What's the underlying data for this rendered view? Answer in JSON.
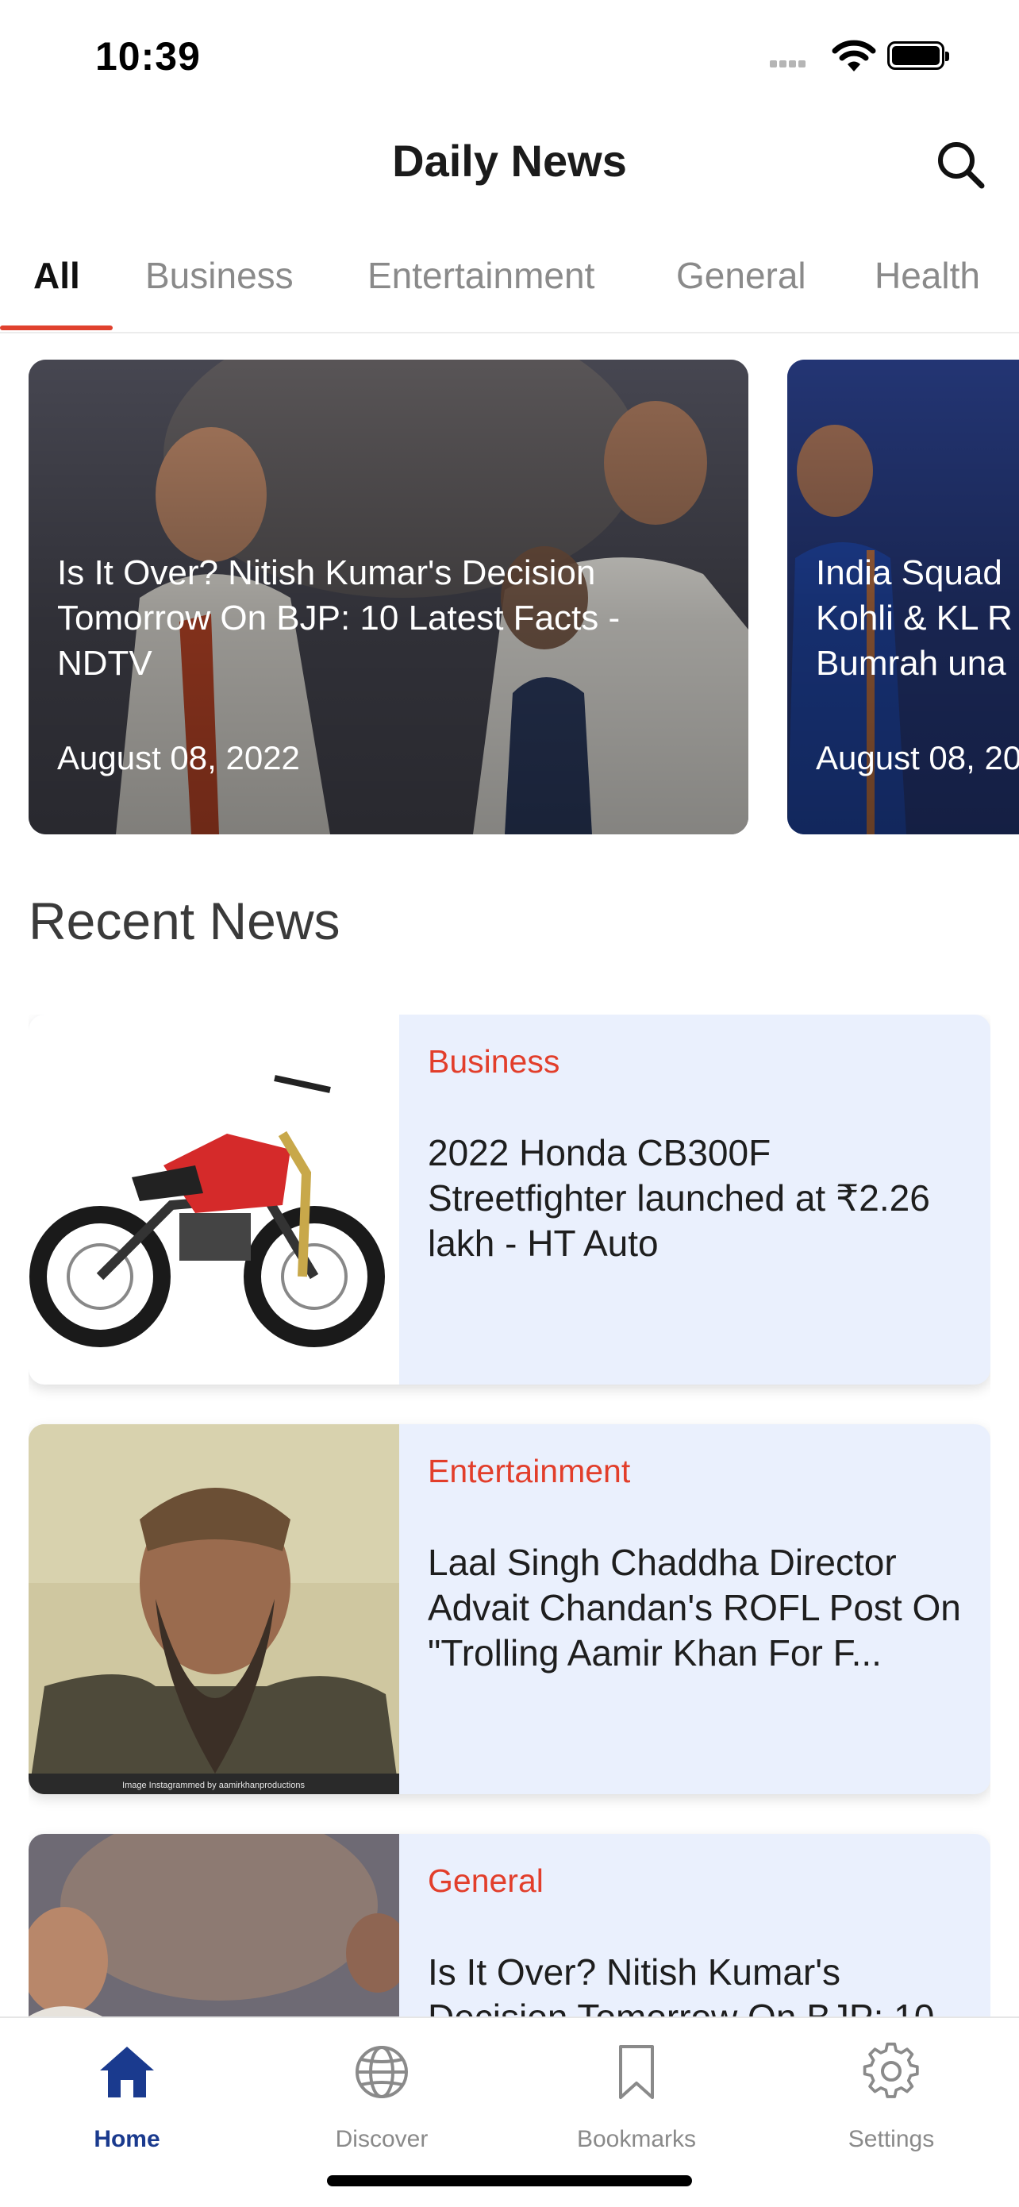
{
  "status_bar": {
    "time": "10:39"
  },
  "header": {
    "title": "Daily News"
  },
  "tabs": [
    {
      "label": "All"
    },
    {
      "label": "Business"
    },
    {
      "label": "Entertainment"
    },
    {
      "label": "General"
    },
    {
      "label": "Health"
    }
  ],
  "featured": [
    {
      "title": "Is It Over? Nitish Kumar's Decision Tomorrow On BJP: 10 Latest Facts - NDTV",
      "date": "August 08, 2022"
    },
    {
      "title": "India Squad ... Kohli & KL R... Bumrah una...",
      "date": "August 08, 20..."
    }
  ],
  "recent": {
    "heading": "Recent News",
    "items": [
      {
        "category": "Business",
        "title": "2022 Honda CB300F Streetfighter launched at ₹2.26 lakh - HT Auto"
      },
      {
        "category": "Entertainment",
        "title": "Laal Singh Chaddha Director Advait Chandan's ROFL Post On \"Trolling Aamir Khan For F...",
        "image_caption": "Image Instagrammed by aamirkhanproductions"
      },
      {
        "category": "General",
        "title": "Is It Over? Nitish Kumar's Decision Tomorrow On BJP: 10"
      }
    ]
  },
  "nav": [
    {
      "label": "Home",
      "icon": "home-icon"
    },
    {
      "label": "Discover",
      "icon": "globe-icon"
    },
    {
      "label": "Bookmarks",
      "icon": "bookmark-icon"
    },
    {
      "label": "Settings",
      "icon": "gear-icon"
    }
  ],
  "colors": {
    "accent": "#e0412e",
    "active_nav": "#1a3a8e",
    "card_bg": "#eaf0fd"
  }
}
